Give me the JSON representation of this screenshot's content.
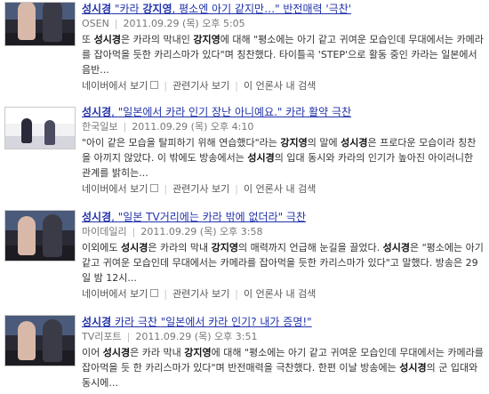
{
  "results": [
    {
      "title_prefix": "성시경",
      "title_sep": " \"카라 ",
      "title_bold": "강지영",
      "title_rest": ", 평소엔 아기 같지만…\" 반전매력 '극찬'",
      "source": "OSEN",
      "datetime": "2011.09.29 (목) 오후 5:05",
      "desc_parts": [
        {
          "t": "또 "
        },
        {
          "t": "성시경",
          "b": true
        },
        {
          "t": "은 카라의 막내인 "
        },
        {
          "t": "강지영",
          "b": true
        },
        {
          "t": "에 대해 \"평소에는 아기 같고 귀여운 모습인데 무대에서는 카메라를 잡아먹을 듯한 카리스마가 있다\"며 칭찬했다. 타이틀곡 'STEP'으로 활동 중인 카라는 일본에서 음반..."
        }
      ],
      "actions": [
        "네이버에서 보기",
        "관련기사 보기",
        "이 언론사 내 검색"
      ]
    },
    {
      "title_prefix": "성시경",
      "title_sep": ", ",
      "title_bold": "",
      "title_rest": "\"일본에서 카라 인기 장난 아니예요.\" 카라 활약 극찬",
      "source": "한국일보",
      "datetime": "2011.09.29 (목) 오후 4:10",
      "desc_parts": [
        {
          "t": "\"아이 같은 모습을 탈피하기 위해 연습했다\"라는 "
        },
        {
          "t": "강지영",
          "b": true
        },
        {
          "t": "의 말에 "
        },
        {
          "t": "성시경",
          "b": true
        },
        {
          "t": "은 프로다운 모습이라 칭찬을 아끼지 않았다. 이 밖에도 방송에서는 "
        },
        {
          "t": "성시경",
          "b": true
        },
        {
          "t": "의 입대 동시와 카라의 인기가 높아진 아이러니한 관계를 밝히는..."
        }
      ],
      "actions": [
        "네이버에서 보기",
        "관련기사 보기",
        "이 언론사 내 검색"
      ]
    },
    {
      "title_prefix": "성시경",
      "title_sep": ", ",
      "title_bold": "",
      "title_rest": "\"일본 TV거리에는 카라 밖에 없더라\" 극찬",
      "source": "마이데일리",
      "datetime": "2011.09.29 (목) 오후 3:58",
      "desc_parts": [
        {
          "t": "이외에도 "
        },
        {
          "t": "성시경",
          "b": true
        },
        {
          "t": "은 카라의 막내 "
        },
        {
          "t": "강지영",
          "b": true
        },
        {
          "t": "의 매력까지 언급해 눈길을 끌었다. "
        },
        {
          "t": "성시경",
          "b": true
        },
        {
          "t": "은 \"평소에는 아기 같고 귀여운 모습인데 무대에서는 카메라를 잡아먹을 듯한 카리스마가 있다\"고 말했다. 방송은 29일 밤 12시..."
        }
      ],
      "actions": [
        "네이버에서 보기",
        "관련기사 보기",
        "이 언론사 내 검색"
      ]
    },
    {
      "title_prefix": "성시경",
      "title_sep": " 카라 극찬 ",
      "title_bold": "",
      "title_rest": "\"일본에서 카라 인기? 내가 증명!\"",
      "source": "TV리포트",
      "datetime": "2011.09.29 (목) 오후 3:51",
      "desc_parts": [
        {
          "t": "이어 "
        },
        {
          "t": "성시경",
          "b": true
        },
        {
          "t": "은 카라 막내 "
        },
        {
          "t": "강지영",
          "b": true
        },
        {
          "t": "에 대해 \"평소에는 아기 같고 귀여운 모습인데 무대에서는 카메라를 잡아먹을 듯 한 카리스마가 있다\"며 반전매력을 극찬했다. 한편 이날 방송에는 "
        },
        {
          "t": "성시경",
          "b": true
        },
        {
          "t": "의 군 입대와 동시에..."
        }
      ],
      "actions": []
    }
  ]
}
